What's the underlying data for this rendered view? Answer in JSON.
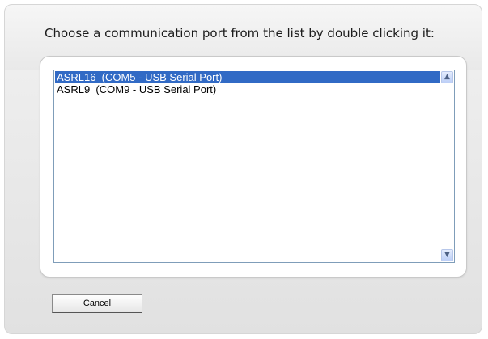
{
  "dialog": {
    "prompt": "Choose a communication port from the list by double clicking it:",
    "ports": [
      {
        "label": "ASRL16  (COM5 - USB Serial Port)",
        "selected": true
      },
      {
        "label": "ASRL9  (COM9 - USB Serial Port)",
        "selected": false
      }
    ],
    "cancel_label": "Cancel"
  },
  "colors": {
    "selection": "#316ac5",
    "panel": "#e6e6e6",
    "listbox_border": "#7f9db9"
  },
  "icons": {
    "scroll_up": "chevron-up-icon",
    "scroll_down": "chevron-down-icon"
  }
}
